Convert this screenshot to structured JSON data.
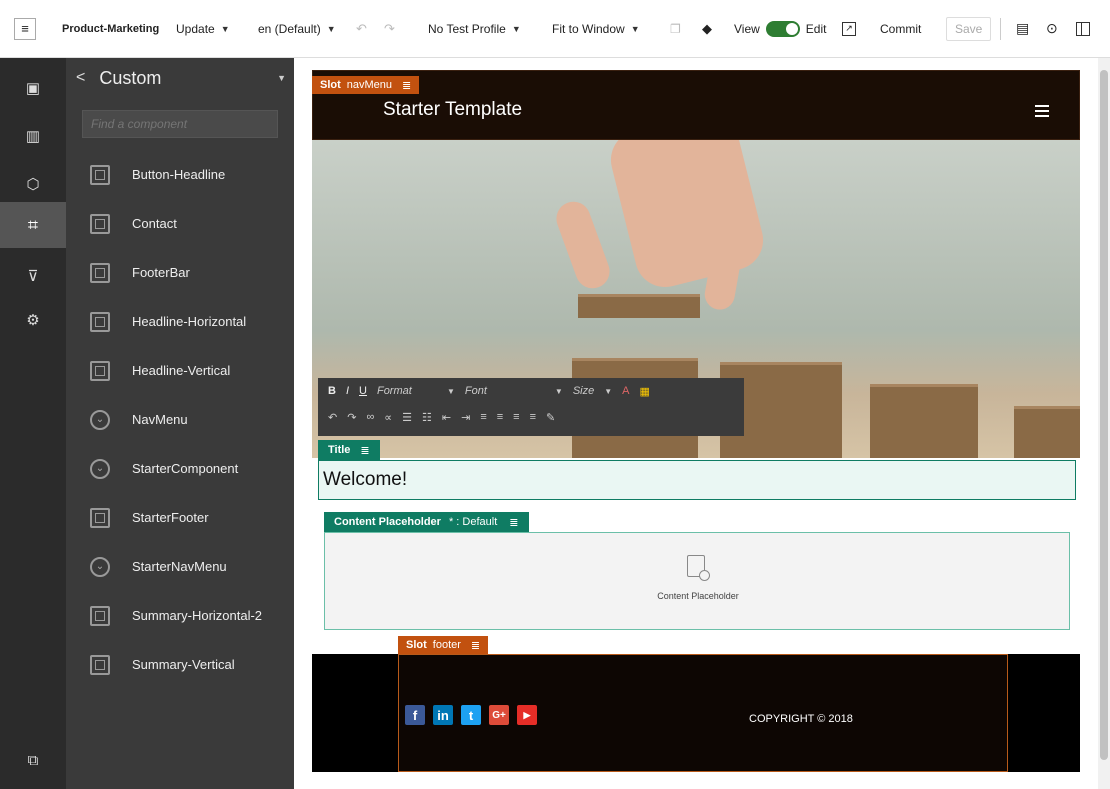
{
  "toolbar": {
    "site": "Product-Marketing",
    "update": "Update",
    "language": "en (Default)",
    "profile": "No Test Profile",
    "fit": "Fit to Window",
    "view": "View",
    "edit": "Edit",
    "commit": "Commit",
    "save": "Save"
  },
  "panel": {
    "title": "Custom",
    "search_placeholder": "Find a component",
    "components": [
      {
        "label": "Button-Headline",
        "icon": "square"
      },
      {
        "label": "Contact",
        "icon": "square"
      },
      {
        "label": "FooterBar",
        "icon": "square"
      },
      {
        "label": "Headline-Horizontal",
        "icon": "square"
      },
      {
        "label": "Headline-Vertical",
        "icon": "square"
      },
      {
        "label": "NavMenu",
        "icon": "circle"
      },
      {
        "label": "StarterComponent",
        "icon": "circle"
      },
      {
        "label": "StarterFooter",
        "icon": "square"
      },
      {
        "label": "StarterNavMenu",
        "icon": "circle"
      },
      {
        "label": "Summary-Horizontal-2",
        "icon": "square"
      },
      {
        "label": "Summary-Vertical",
        "icon": "square"
      }
    ]
  },
  "canvas": {
    "slot_nav_kw": "Slot",
    "slot_nav_name": "navMenu",
    "nav_title": "Starter Template",
    "rte": {
      "format": "Format",
      "font": "Font",
      "size": "Size"
    },
    "title_tag": "Title",
    "title_text": "Welcome!",
    "content_tag": "Content Placeholder",
    "content_tag_suffix": "* : Default",
    "content_label": "Content Placeholder",
    "slot_footer_kw": "Slot",
    "slot_footer_name": "footer",
    "copyright": "COPYRIGHT © 2018"
  },
  "colors": {
    "accent_green": "#0f7c63",
    "slot_orange": "#c2510f",
    "rail_bg": "#2b2b2b",
    "panel_bg": "#3a3a3a"
  }
}
